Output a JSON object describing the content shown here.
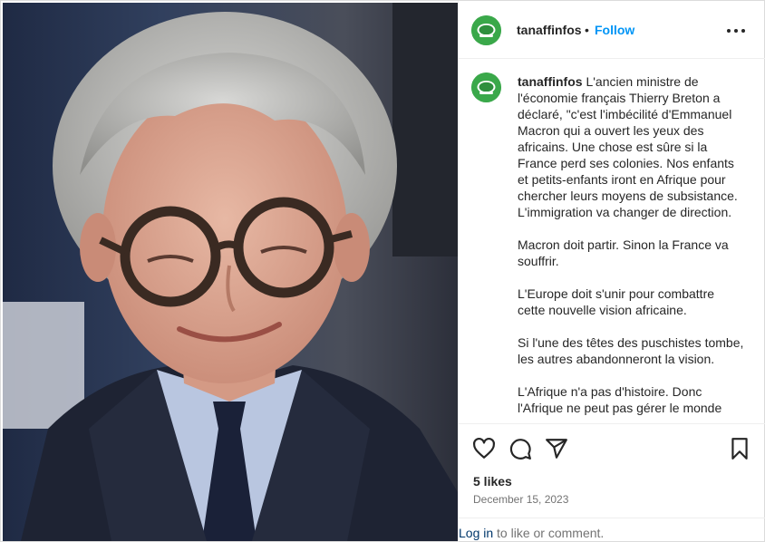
{
  "post": {
    "username": "tanaffinfos",
    "dot": "•",
    "follow_label": "Follow",
    "more_icon": "more-options-icon",
    "image_alt": "Portrait photo of a grey-haired man wearing round tortoiseshell glasses, dark suit and tie"
  },
  "caption": {
    "username": "tanaffinfos",
    "paragraphs": [
      "L'ancien ministre de l'économie français Thierry Breton a déclaré, \"c'est l'imbécilité d'Emmanuel Macron qui a ouvert les yeux des africains. Une chose est sûre si la France perd ses colonies. Nos enfants et petits-enfants iront en Afrique pour chercher leurs moyens de subsistance. L'immigration va changer de direction.",
      "Macron doit partir. Sinon la France va souffrir.",
      "L'Europe doit s'unir pour combattre cette nouvelle vision africaine.",
      "Si l'une des têtes des puschistes tombe, les autres abandonneront la vision.",
      "L'Afrique n'a pas d'histoire. Donc l'Afrique ne peut pas gérer le monde"
    ]
  },
  "actions": {
    "like_icon": "heart-icon",
    "comment_icon": "comment-icon",
    "share_icon": "share-icon",
    "save_icon": "bookmark-icon"
  },
  "stats": {
    "likes": "5 likes",
    "date": "December 15, 2023"
  },
  "footer": {
    "login_label": "Log in",
    "login_suffix": " to like or comment."
  },
  "colors": {
    "link_blue": "#0095f6",
    "avatar_green": "#3aa84a",
    "muted_text": "#737373"
  }
}
